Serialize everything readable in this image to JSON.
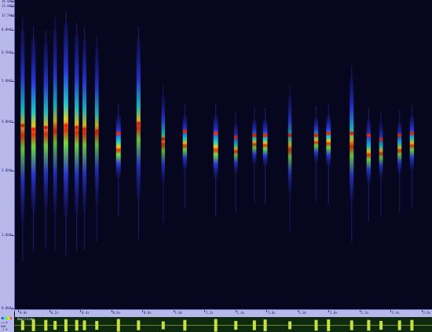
{
  "frequency_axis": {
    "labels": [
      "16.0kHz",
      "15.0kHz",
      "12.5kHz",
      "8.0kHz",
      "6.5kHz",
      "5.0kHz",
      "4.0kHz",
      "3.0kHz",
      "1.6kHz",
      "0.0kHz"
    ]
  },
  "time_axis": {
    "labels": [
      "0.0s",
      "0.2s",
      "0.4s",
      "0.6s",
      "0.8s",
      "1.0s",
      "1.2s",
      "1.4s",
      "1.6s",
      "1.8s",
      "2.0s",
      "2.2s",
      "2.4s",
      "2.6s"
    ]
  },
  "waveform": {
    "title": "Amplitude",
    "amp_labels": [
      "+1.0",
      "0dB",
      "-1.0"
    ]
  },
  "colors": {
    "background": "#06061e",
    "axis_panel": "#b8b8ea",
    "waveform_bg": "#0e2a0e",
    "waveform_line": "#c8e040"
  },
  "chart_data": {
    "type": "heatmap",
    "title": "",
    "xlabel": "",
    "ylabel": "",
    "x_unit": "s",
    "y_unit": "kHz",
    "xlim": [
      0,
      2.7
    ],
    "ylim": [
      0,
      16
    ],
    "calls": [
      {
        "t": 0.05,
        "f_peak": 9.5,
        "f_hi": 14.5,
        "f_lo": 4.5,
        "intensity": 0.7
      },
      {
        "t": 0.12,
        "f_peak": 9.3,
        "f_hi": 14.0,
        "f_lo": 5.0,
        "intensity": 0.9
      },
      {
        "t": 0.2,
        "f_peak": 9.4,
        "f_hi": 13.8,
        "f_lo": 5.2,
        "intensity": 0.8
      },
      {
        "t": 0.26,
        "f_peak": 9.2,
        "f_hi": 14.5,
        "f_lo": 5.0,
        "intensity": 0.6
      },
      {
        "t": 0.33,
        "f_peak": 9.5,
        "f_hi": 14.8,
        "f_lo": 4.8,
        "intensity": 0.95
      },
      {
        "t": 0.4,
        "f_peak": 9.4,
        "f_hi": 14.2,
        "f_lo": 5.0,
        "intensity": 0.8
      },
      {
        "t": 0.45,
        "f_peak": 9.3,
        "f_hi": 14.0,
        "f_lo": 5.1,
        "intensity": 0.7
      },
      {
        "t": 0.53,
        "f_peak": 9.2,
        "f_hi": 13.5,
        "f_lo": 5.5,
        "intensity": 0.6
      },
      {
        "t": 0.67,
        "f_peak": 9.1,
        "f_hi": 10.0,
        "f_lo": 6.8,
        "intensity": 1.0
      },
      {
        "t": 0.8,
        "f_peak": 9.6,
        "f_hi": 14.0,
        "f_lo": 5.6,
        "intensity": 0.7
      },
      {
        "t": 0.96,
        "f_peak": 8.8,
        "f_hi": 11.0,
        "f_lo": 6.5,
        "intensity": 0.5
      },
      {
        "t": 1.1,
        "f_peak": 9.2,
        "f_hi": 10.0,
        "f_lo": 7.2,
        "intensity": 0.8
      },
      {
        "t": 1.3,
        "f_peak": 9.1,
        "f_hi": 10.0,
        "f_lo": 6.8,
        "intensity": 1.0
      },
      {
        "t": 1.43,
        "f_peak": 8.9,
        "f_hi": 9.6,
        "f_lo": 7.0,
        "intensity": 0.6
      },
      {
        "t": 1.55,
        "f_peak": 9.0,
        "f_hi": 9.8,
        "f_lo": 7.5,
        "intensity": 0.7
      },
      {
        "t": 1.62,
        "f_peak": 9.0,
        "f_hi": 9.8,
        "f_lo": 7.4,
        "intensity": 0.9
      },
      {
        "t": 1.78,
        "f_peak": 9.0,
        "f_hi": 11.0,
        "f_lo": 6.0,
        "intensity": 0.5
      },
      {
        "t": 1.95,
        "f_peak": 9.0,
        "f_hi": 9.9,
        "f_lo": 7.6,
        "intensity": 0.8
      },
      {
        "t": 2.03,
        "f_peak": 9.1,
        "f_hi": 10.0,
        "f_lo": 7.4,
        "intensity": 0.9
      },
      {
        "t": 2.18,
        "f_peak": 9.1,
        "f_hi": 12.0,
        "f_lo": 5.5,
        "intensity": 0.7
      },
      {
        "t": 2.29,
        "f_peak": 9.0,
        "f_hi": 9.8,
        "f_lo": 6.5,
        "intensity": 0.8
      },
      {
        "t": 2.37,
        "f_peak": 8.8,
        "f_hi": 9.6,
        "f_lo": 6.8,
        "intensity": 0.6
      },
      {
        "t": 2.49,
        "f_peak": 9.0,
        "f_hi": 9.7,
        "f_lo": 7.0,
        "intensity": 0.7
      },
      {
        "t": 2.57,
        "f_peak": 9.1,
        "f_hi": 10.0,
        "f_lo": 7.2,
        "intensity": 0.8
      }
    ]
  }
}
